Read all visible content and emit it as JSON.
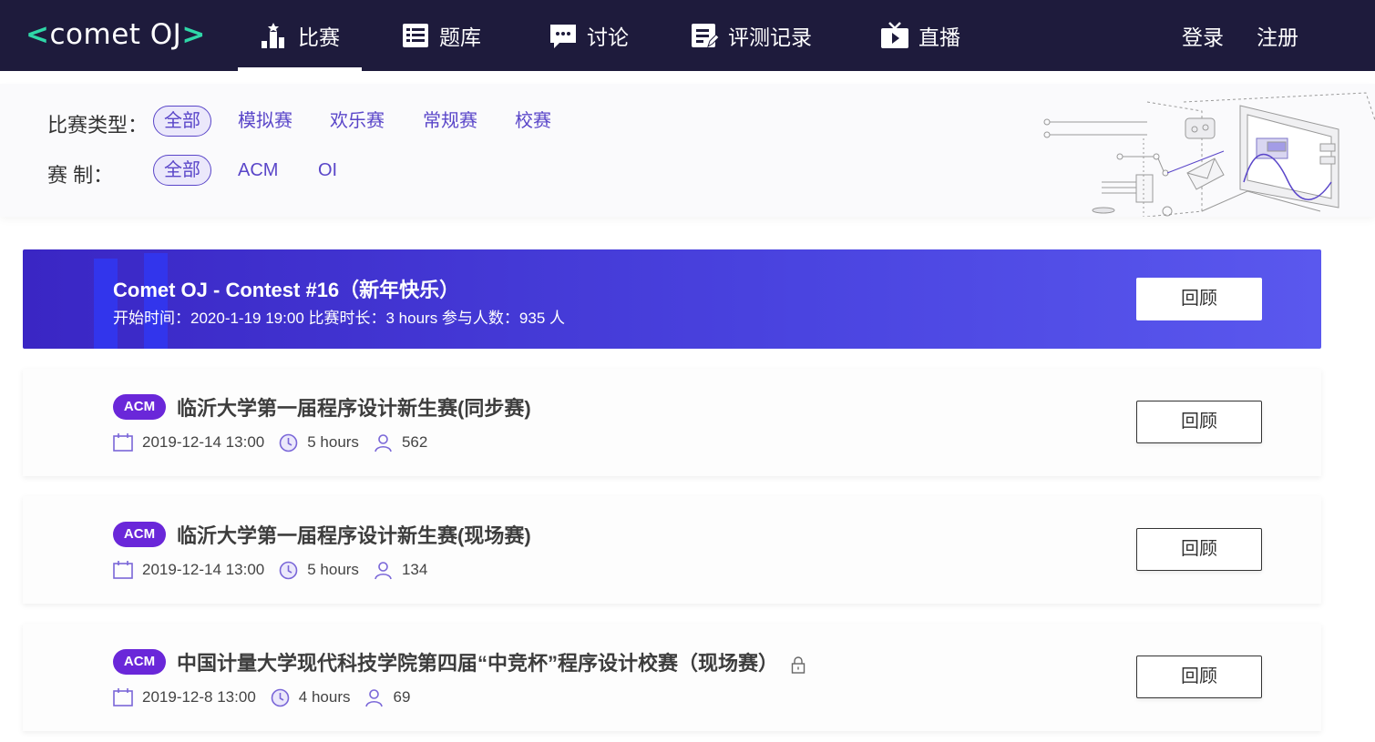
{
  "nav": {
    "logo_left": "<",
    "logo_text": "comet OJ",
    "logo_right": ">",
    "items": [
      {
        "label": "比赛",
        "icon": "ranking-icon",
        "active": true
      },
      {
        "label": "题库",
        "icon": "list-icon"
      },
      {
        "label": "讨论",
        "icon": "chat-icon"
      },
      {
        "label": "评测记录",
        "icon": "edit-record-icon"
      },
      {
        "label": "直播",
        "icon": "tv-icon"
      }
    ],
    "login": "登录",
    "register": "注册"
  },
  "filters": {
    "type_label": "比赛类型：",
    "types": [
      "全部",
      "模拟赛",
      "欢乐赛",
      "常规赛",
      "校赛"
    ],
    "format_label": "赛 制：",
    "formats": [
      "全部",
      "ACM",
      "OI"
    ]
  },
  "featured": {
    "title": "Comet OJ - Contest #16（新年快乐）",
    "meta": "开始时间：2020-1-19 19:00 比赛时长：3 hours 参与人数：935 人",
    "button": "回顾"
  },
  "contests": [
    {
      "badge": "ACM",
      "title": "临沂大学第一届程序设计新生赛(同步赛)",
      "date": "2019-12-14 13:00",
      "duration": "5 hours",
      "participants": "562",
      "button": "回顾",
      "locked": false
    },
    {
      "badge": "ACM",
      "title": "临沂大学第一届程序设计新生赛(现场赛)",
      "date": "2019-12-14 13:00",
      "duration": "5 hours",
      "participants": "134",
      "button": "回顾",
      "locked": false
    },
    {
      "badge": "ACM",
      "title": "中国计量大学现代科技学院第四届“中竞杯”程序设计校赛（现场赛）",
      "date": "2019-12-8 13:00",
      "duration": "4 hours",
      "participants": "69",
      "button": "回顾",
      "locked": true
    }
  ],
  "colors": {
    "nav_bg": "#1e1b3c",
    "logo_accent": "#2fd7a8",
    "primary": "#5a46c9",
    "badge": "#6a27d9",
    "featured_start": "#3a26c4",
    "featured_end": "#5a58ee"
  }
}
